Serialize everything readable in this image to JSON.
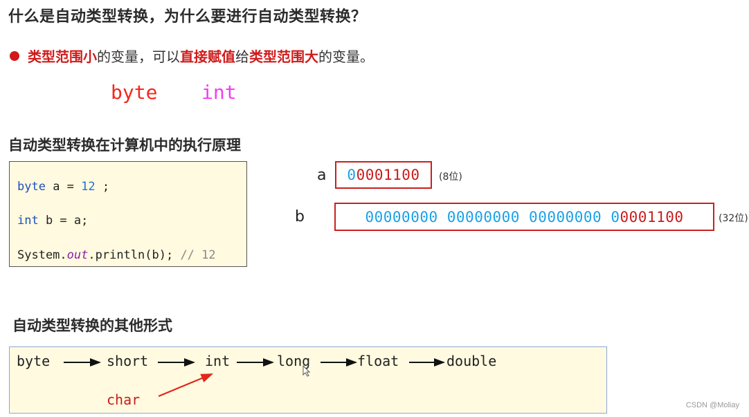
{
  "heading_main": "什么是自动类型转换，为什么要进行自动类型转换？",
  "bullet": {
    "part1": "类型范围小",
    "part2": "的变量，可以",
    "part3": "直接赋值",
    "part4": "给",
    "part5": "类型范围大",
    "part6": "的变量。"
  },
  "examples": {
    "small_type": "byte",
    "large_type": "int"
  },
  "heading_principle": "自动类型转换在计算机中的执行原理",
  "code": {
    "line1": {
      "kw": "byte",
      "mid": " a = ",
      "num": "12",
      "end": " ;"
    },
    "line2": {
      "kw": "int",
      "rest": " b = a;"
    },
    "line3": {
      "pre": "System.",
      "field": "out",
      "post": ".println(b); ",
      "comment": "// 12"
    }
  },
  "memory": {
    "a": {
      "label": "a",
      "lead_bit": "0",
      "bits": "0001100",
      "note": "(8位)"
    },
    "b": {
      "label": "b",
      "zeros": "00000000 00000000 00000000 0",
      "bits": "0001100",
      "note": "(32位)"
    }
  },
  "heading_forms": "自动类型转换的其他形式",
  "flow": {
    "types": [
      "byte",
      "short",
      "int",
      "long",
      "float",
      "double"
    ],
    "side_type": "char"
  },
  "colors": {
    "accent_red": "#d01a1a",
    "bit_blue": "#1aa0e8",
    "code_bg": "#fffae0"
  },
  "watermark": "CSDN @Moliay"
}
